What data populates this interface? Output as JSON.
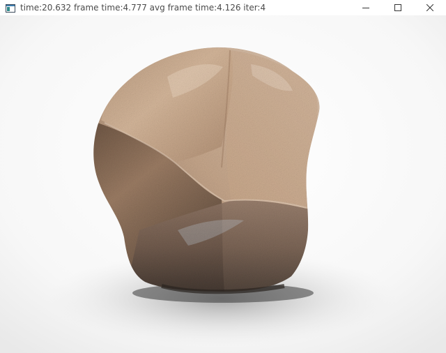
{
  "window": {
    "title": "time:20.632 frame time:4.777 avg frame time:4.126 iter:4",
    "app_icon": "app-window-icon",
    "controls": {
      "minimize_icon": "minimize-icon",
      "maximize_icon": "maximize-icon",
      "close_icon": "close-icon"
    }
  },
  "viewport": {
    "subject": "rendered-rock",
    "background_color": "#f2f2f2",
    "rock_colors": {
      "top": "#c9a788",
      "mid": "#a47f62",
      "dark": "#5f4a3a",
      "highlight": "#e2cbb5"
    }
  }
}
